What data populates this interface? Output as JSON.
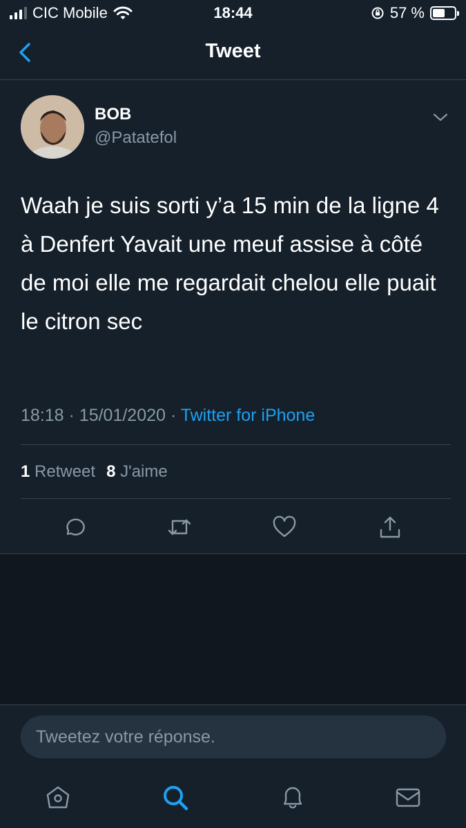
{
  "status_bar": {
    "carrier": "CIC Mobile",
    "time": "18:44",
    "battery": "57 %",
    "battery_level": 0.57,
    "icons": [
      "signal-icon",
      "wifi-icon",
      "orientation-lock-icon",
      "battery-icon"
    ]
  },
  "nav": {
    "title": "Tweet",
    "back_icon": "chevron-left-icon"
  },
  "tweet": {
    "display_name": "BOB",
    "handle": "@Patatefol",
    "text": "Waah je suis sorti y’a 15 min de la ligne 4 à Denfert Yavait une meuf assise à côté de moi elle me regardait chelou elle puait le citron sec",
    "time": "18:18",
    "date": "15/01/2020",
    "separator": "·",
    "source": "Twitter for iPhone",
    "retweet_count": "1",
    "retweet_label": "Retweet",
    "like_count": "8",
    "like_label": "J'aime"
  },
  "actions": [
    "reply-icon",
    "retweet-icon",
    "like-icon",
    "share-icon"
  ],
  "reply": {
    "placeholder": "Tweetez votre réponse."
  },
  "tabs": [
    "home-icon",
    "search-icon",
    "notifications-icon",
    "messages-icon"
  ],
  "colors": {
    "background": "#15202b",
    "accent": "#1da1f2",
    "muted": "#8899a6",
    "divider": "#38444d"
  }
}
